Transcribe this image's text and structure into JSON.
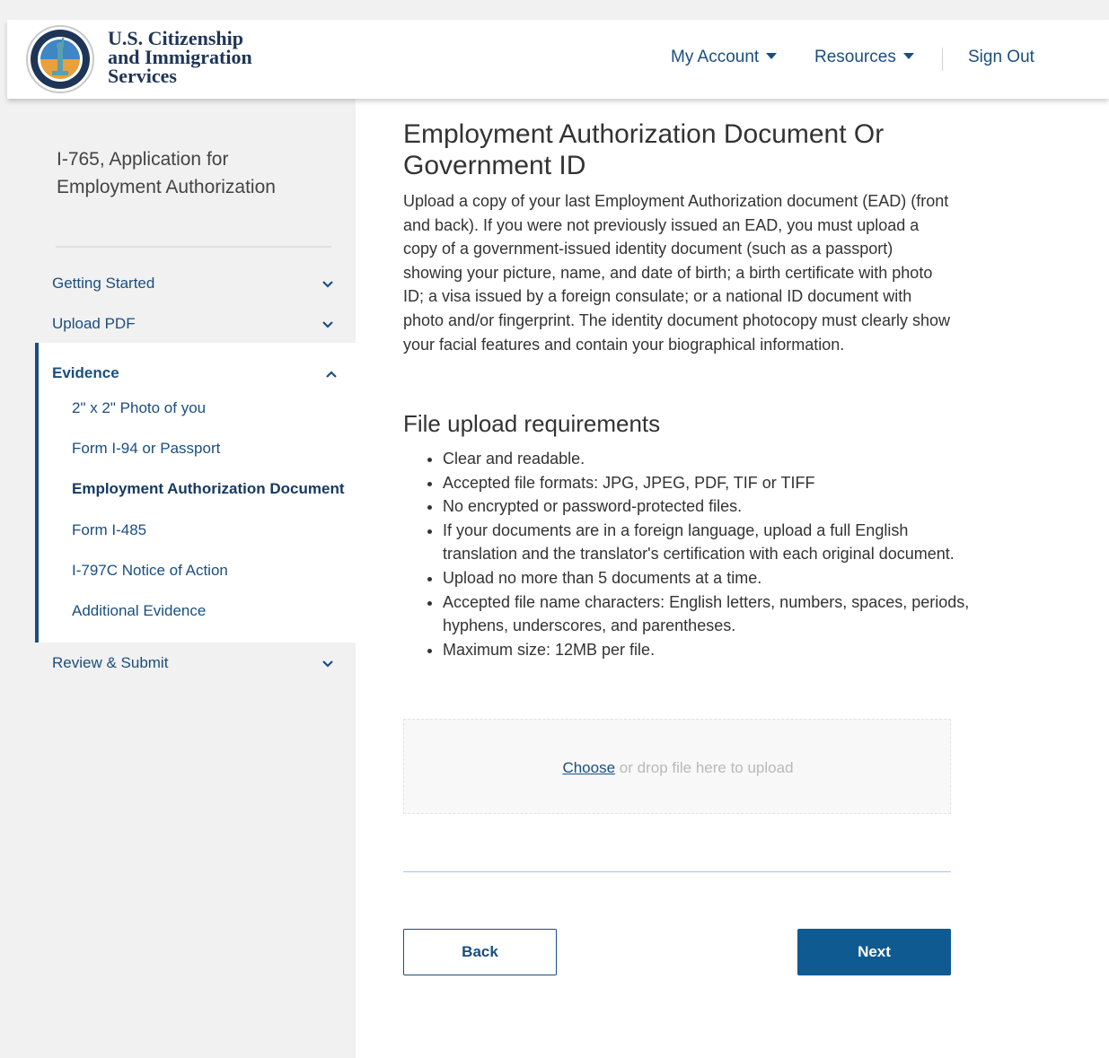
{
  "header": {
    "agency_line1": "U.S. Citizenship",
    "agency_line2": "and Immigration",
    "agency_line3": "Services",
    "nav": {
      "my_account": "My Account",
      "resources": "Resources",
      "sign_out": "Sign Out"
    }
  },
  "sidebar": {
    "title": "I-765, Application for Employment Authorization",
    "sections": [
      {
        "label": "Getting Started"
      },
      {
        "label": "Upload PDF"
      },
      {
        "label": "Evidence"
      },
      {
        "label": "Review & Submit"
      }
    ],
    "evidence_items": [
      {
        "label": "2\" x 2\" Photo of you"
      },
      {
        "label": "Form I-94 or Passport"
      },
      {
        "label": "Employment Authorization Document"
      },
      {
        "label": "Form I-485"
      },
      {
        "label": "I-797C Notice of Action"
      },
      {
        "label": "Additional Evidence"
      }
    ]
  },
  "main": {
    "title": "Employment Authorization Document Or Government ID",
    "intro": "Upload a copy of your last Employment Authorization document (EAD) (front and back). If you were not previously issued an EAD, you must upload a copy of a government-issued identity document (such as a passport) showing your picture, name, and date of birth; a birth certificate with photo ID; a visa issued by a foreign consulate; or a national ID document with photo and/or fingerprint. The identity document photocopy must clearly show your facial features and contain your biographical information.",
    "requirements_title": "File upload requirements",
    "requirements": [
      "Clear and readable.",
      "Accepted file formats: JPG, JPEG, PDF, TIF or TIFF",
      "No encrypted or password-protected files.",
      "If your documents are in a foreign language, upload a full English translation and the translator's certification with each original document.",
      "Upload no more than 5 documents at a time.",
      "Accepted file name characters: English letters, numbers, spaces, periods, hyphens, underscores, and parentheses.",
      "Maximum size: 12MB per file."
    ],
    "upload": {
      "choose_label": "Choose",
      "drop_text": " or drop file here to upload"
    },
    "buttons": {
      "back": "Back",
      "next": "Next"
    }
  },
  "colors": {
    "brand_blue": "#1a4e80",
    "primary_button": "#0f5a91",
    "sidebar_bg": "#f1f1f1"
  },
  "icons": {
    "logo": "uscis-seal-icon",
    "dropdown": "caret-down-icon",
    "expand": "chevron-down-icon",
    "collapse": "chevron-up-icon"
  }
}
